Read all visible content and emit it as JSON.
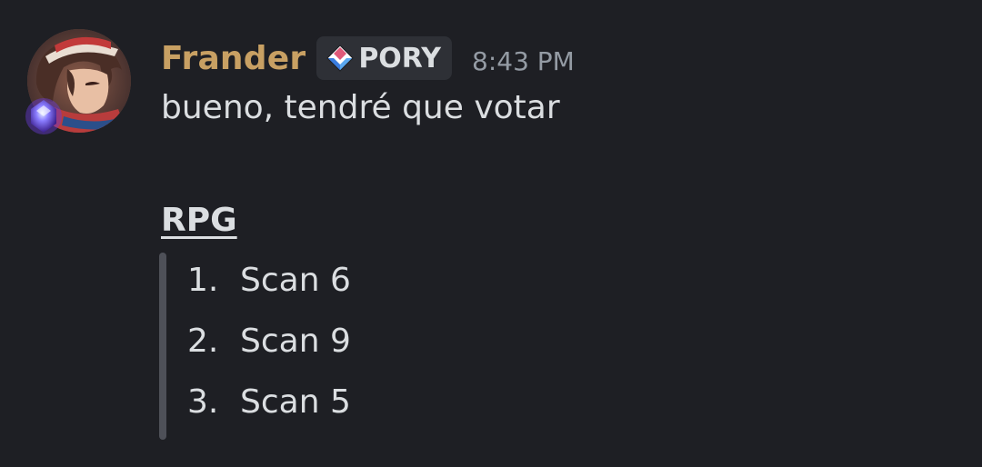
{
  "message": {
    "username": "Frander",
    "tag": "PORY",
    "timestamp": "8:43 PM",
    "text": "bueno, tendré que votar",
    "heading": "RPG",
    "list": [
      {
        "number": "1.",
        "text": "Scan 6"
      },
      {
        "number": "2.",
        "text": "Scan 9"
      },
      {
        "number": "3.",
        "text": "Scan 5"
      }
    ]
  },
  "colors": {
    "background": "#1e1f24",
    "username": "#c8a063",
    "text": "#dbdee1",
    "timestamp": "#949ba4",
    "tag_bg": "#2e3036",
    "quote_bar": "#4e5058"
  },
  "icons": {
    "avatar": "user-avatar",
    "avatar_decoration": "purple-gem-icon",
    "tag_icon": "pory-badge-icon"
  }
}
